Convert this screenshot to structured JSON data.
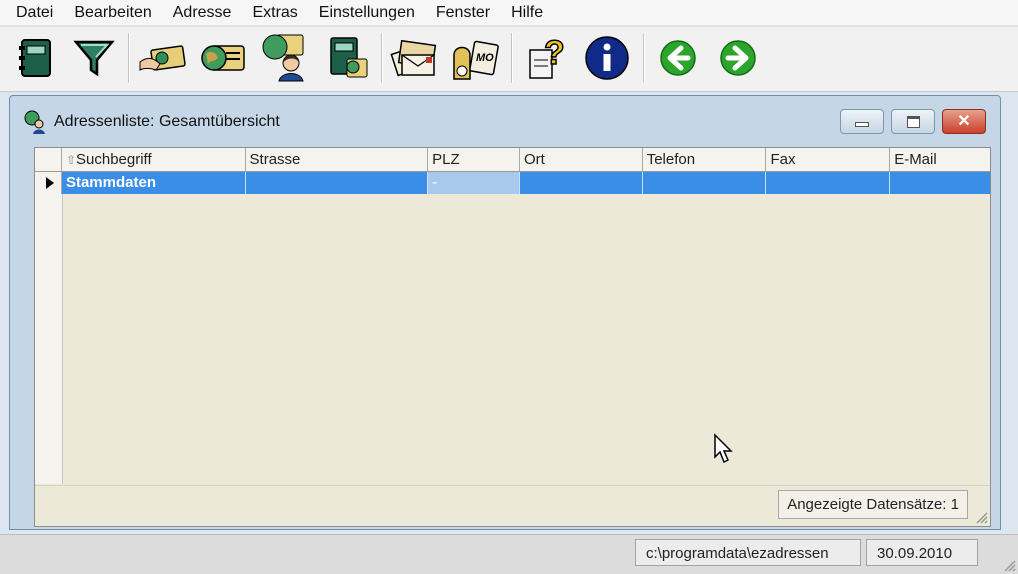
{
  "menu": [
    "Datei",
    "Bearbeiten",
    "Adresse",
    "Extras",
    "Einstellungen",
    "Fenster",
    "Hilfe"
  ],
  "toolbar": {
    "buttons": [
      {
        "name": "address-book-icon"
      },
      {
        "name": "filter-icon"
      },
      {
        "name": "address-card-hand-icon"
      },
      {
        "name": "globe-card-icon"
      },
      {
        "name": "globe-contact-icon"
      },
      {
        "name": "notebook-globe-icon"
      },
      {
        "name": "letters-icon"
      },
      {
        "name": "mo-bag-icon"
      },
      {
        "name": "help-icon"
      },
      {
        "name": "info-icon"
      },
      {
        "name": "back-icon"
      },
      {
        "name": "forward-icon"
      }
    ]
  },
  "window": {
    "title": "Adressenliste: Gesamtübersicht"
  },
  "grid": {
    "columns": [
      "Suchbegriff",
      "Strasse",
      "PLZ",
      "Ort",
      "Telefon",
      "Fax",
      "E-Mail"
    ],
    "sort_glyph": "⇧",
    "rows": [
      {
        "cells": [
          "Stammdaten",
          "",
          "-",
          "",
          "",
          "",
          ""
        ]
      }
    ]
  },
  "inner_status": "Angezeigte Datensätze: 1",
  "statusbar": {
    "path": "c:\\programdata\\ezadressen",
    "date": "30.09.2010"
  },
  "colors": {
    "selection": "#3a8ee6",
    "window_frame": "#c5d7e7",
    "client_bg": "#ece9d8"
  }
}
